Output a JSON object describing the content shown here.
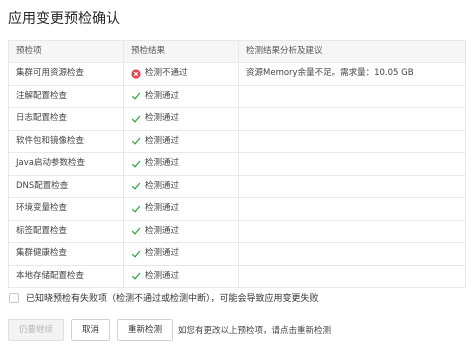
{
  "title": "应用变更预检确认",
  "table": {
    "headers": [
      "预检项",
      "预检结果",
      "检测结果分析及建议"
    ],
    "rows": [
      {
        "item": "集群可用资源检查",
        "status": "fail",
        "result": "检测不通过",
        "advice": "资源Memory余量不足。需求量：10.05 GB"
      },
      {
        "item": "注解配置检查",
        "status": "pass",
        "result": "检测通过",
        "advice": ""
      },
      {
        "item": "日志配置检查",
        "status": "pass",
        "result": "检测通过",
        "advice": ""
      },
      {
        "item": "软件包和镜像检查",
        "status": "pass",
        "result": "检测通过",
        "advice": ""
      },
      {
        "item": "Java启动参数检查",
        "status": "pass",
        "result": "检测通过",
        "advice": ""
      },
      {
        "item": "DNS配置检查",
        "status": "pass",
        "result": "检测通过",
        "advice": ""
      },
      {
        "item": "环境变量检查",
        "status": "pass",
        "result": "检测通过",
        "advice": ""
      },
      {
        "item": "标签配置检查",
        "status": "pass",
        "result": "检测通过",
        "advice": ""
      },
      {
        "item": "集群健康检查",
        "status": "pass",
        "result": "检测通过",
        "advice": ""
      },
      {
        "item": "本地存储配置检查",
        "status": "pass",
        "result": "检测通过",
        "advice": ""
      }
    ]
  },
  "acknowledge": {
    "checked": false,
    "label": "已知晓预检有失败项（检测不通过或检测中断），可能会导致应用变更失败"
  },
  "buttons": {
    "continue": "仍要继续",
    "cancel": "取消",
    "recheck": "重新检测"
  },
  "hint": "如您有更改以上预检项，请点击重新检测",
  "colors": {
    "pass": "#3aa64a",
    "fail": "#e0474f"
  }
}
